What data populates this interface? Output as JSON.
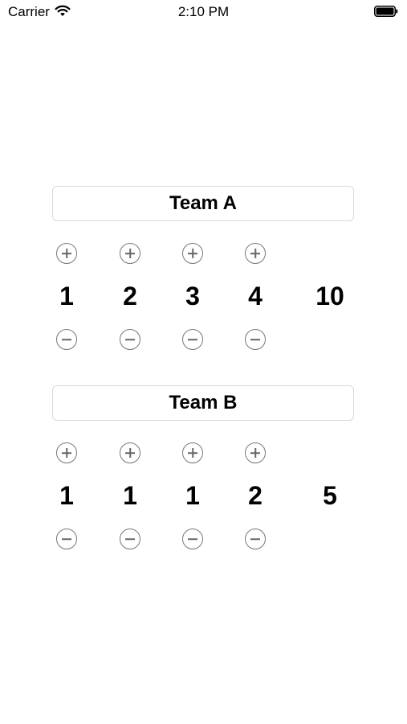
{
  "status_bar": {
    "carrier": "Carrier",
    "time": "2:10 PM",
    "wifi_icon": "wifi-icon",
    "battery_icon": "battery-icon"
  },
  "teams": [
    {
      "name": "Team A",
      "scores": [
        "1",
        "2",
        "3",
        "4"
      ],
      "total": "10"
    },
    {
      "name": "Team B",
      "scores": [
        "1",
        "1",
        "1",
        "2"
      ],
      "total": "5"
    }
  ],
  "icons": {
    "increment": "plus-circle-icon",
    "decrement": "minus-circle-icon"
  }
}
